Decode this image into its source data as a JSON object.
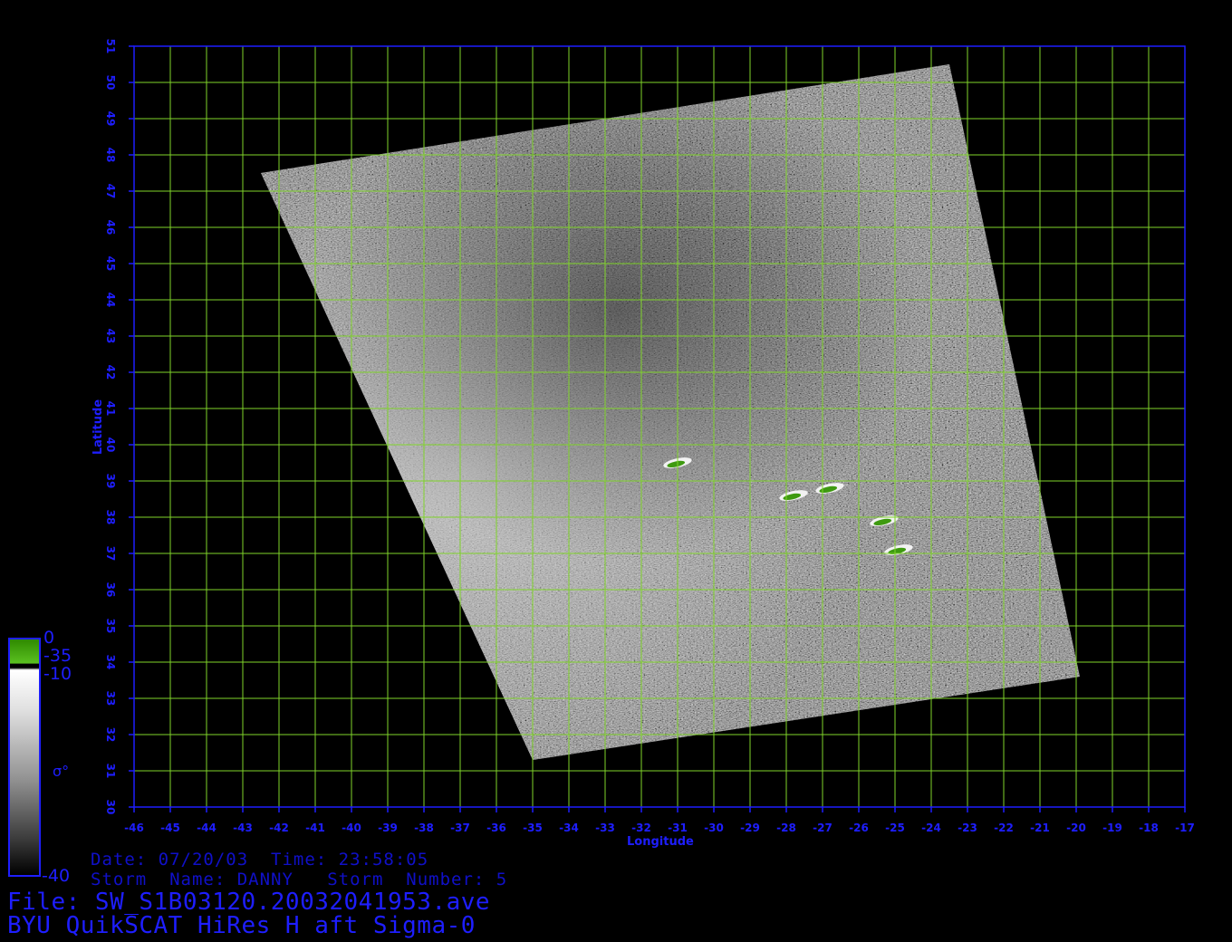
{
  "map": {
    "lon_ticks": [
      "-46",
      "-45",
      "-44",
      "-43",
      "-42",
      "-41",
      "-40",
      "-39",
      "-38",
      "-37",
      "-36",
      "-35",
      "-34",
      "-33",
      "-32",
      "-31",
      "-30",
      "-29",
      "-28",
      "-27",
      "-26",
      "-25",
      "-24",
      "-23",
      "-22",
      "-21",
      "-20",
      "-19",
      "-18",
      "-17"
    ],
    "lat_ticks": [
      "30",
      "31",
      "32",
      "33",
      "34",
      "35",
      "36",
      "37",
      "38",
      "39",
      "40",
      "41",
      "42",
      "43",
      "44",
      "45",
      "46",
      "47",
      "48",
      "49",
      "50",
      "51"
    ],
    "xlabel": "Longitude",
    "ylabel": "Latitude",
    "lon_range": [
      -46,
      -17
    ],
    "lat_range": [
      30,
      51
    ],
    "grid_color": "#7fd32a",
    "frame_color": "#1e1eff",
    "swath_corners_lonlat": [
      [
        -42.5,
        47.5
      ],
      [
        -23.5,
        50.5
      ],
      [
        -19.9,
        33.6
      ],
      [
        -35.0,
        31.3
      ]
    ],
    "high_backscatter_features": [
      {
        "lon": -31.0,
        "lat": 39.5
      },
      {
        "lon": -27.8,
        "lat": 38.6
      },
      {
        "lon": -26.8,
        "lat": 38.8
      },
      {
        "lon": -25.3,
        "lat": 37.9
      },
      {
        "lon": -24.9,
        "lat": 37.1
      }
    ]
  },
  "colorbar": {
    "label_0": "0",
    "label_m35": "-35",
    "label_m10": "-10",
    "label_sigma": "σ°",
    "label_m40": "-40"
  },
  "info": {
    "date_line": "Date: 07/20/03  Time: 23:58:05",
    "storm_line": "Storm  Name: DANNY   Storm  Number: 5",
    "file_line": "File: SW_S1B03120.20032041953.ave",
    "product_line": "BYU QuikSCAT HiRes H aft Sigma-0"
  }
}
